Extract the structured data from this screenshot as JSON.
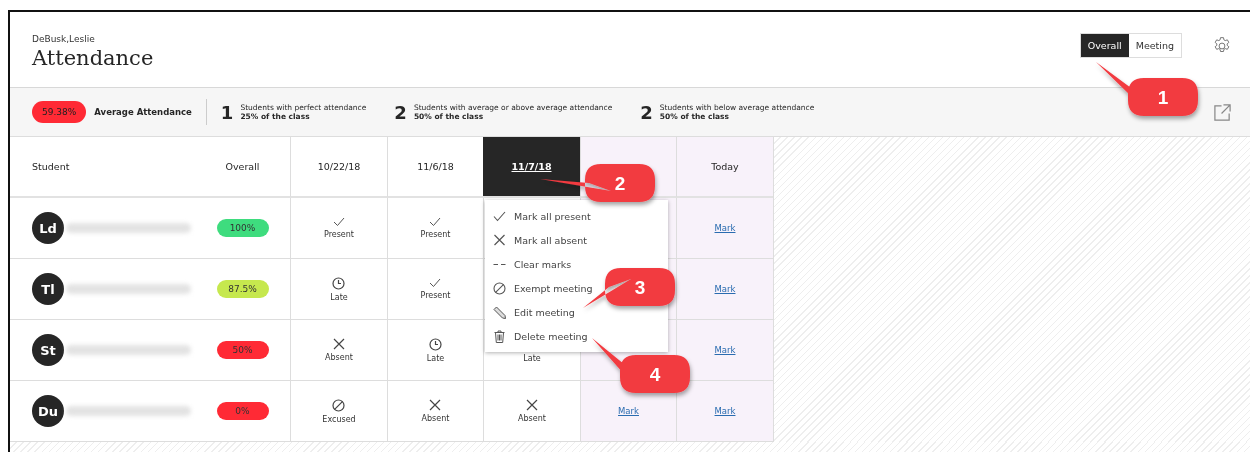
{
  "header": {
    "user_name": "DeBusk,Leslie",
    "title": "Attendance"
  },
  "view_tabs": [
    {
      "label": "Overall",
      "selected": true
    },
    {
      "label": "Meeting",
      "selected": false
    }
  ],
  "summary": {
    "average": {
      "value": "59.38%",
      "label": "Average Attendance",
      "color": "#ff2a35"
    },
    "stats": [
      {
        "count": "1",
        "description": "Students with perfect attendance",
        "share": "25% of the class"
      },
      {
        "count": "2",
        "description": "Students with average or above average attendance",
        "share": "50% of the class"
      },
      {
        "count": "2",
        "description": "Students with below average attendance",
        "share": "50% of the class"
      }
    ]
  },
  "table": {
    "columns": [
      {
        "label": "Student"
      },
      {
        "label": "Overall"
      }
    ],
    "meetings": [
      {
        "label": "10/22/18",
        "selected": false,
        "shaded": false
      },
      {
        "label": "11/6/18",
        "selected": false,
        "shaded": false
      },
      {
        "label": "11/7/18",
        "selected": true,
        "shaded": false
      },
      {
        "selected": false,
        "shaded": true
      },
      {
        "label": "Today",
        "selected": false,
        "shaded": true
      }
    ],
    "rows": [
      {
        "initials": "Ld",
        "overall": "100%",
        "color": "#3edc7e",
        "cells": [
          {
            "kind": "present",
            "label": "Present"
          },
          {
            "kind": "present",
            "label": "Present"
          },
          null,
          null,
          {
            "kind": "mark",
            "label": "Mark"
          }
        ]
      },
      {
        "initials": "Tl",
        "overall": "87.5%",
        "color": "#c6e84e",
        "cells": [
          {
            "kind": "late",
            "label": "Late"
          },
          {
            "kind": "present",
            "label": "Present"
          },
          null,
          null,
          {
            "kind": "mark",
            "label": "Mark"
          }
        ]
      },
      {
        "initials": "St",
        "overall": "50%",
        "color": "#ff2a35",
        "cells": [
          {
            "kind": "absent",
            "label": "Absent"
          },
          {
            "kind": "late",
            "label": "Late"
          },
          {
            "kind": "late",
            "label": "Late"
          },
          null,
          {
            "kind": "mark",
            "label": "Mark"
          }
        ]
      },
      {
        "initials": "Du",
        "overall": "0%",
        "color": "#ff2a35",
        "cells": [
          {
            "kind": "excused",
            "label": "Excused"
          },
          {
            "kind": "absent",
            "label": "Absent"
          },
          {
            "kind": "absent",
            "label": "Absent"
          },
          {
            "kind": "mark",
            "label": "Mark"
          },
          {
            "kind": "mark",
            "label": "Mark"
          }
        ]
      }
    ]
  },
  "meeting_menu": [
    {
      "kind": "check",
      "label": "Mark all present"
    },
    {
      "kind": "cross",
      "label": "Mark all absent"
    },
    {
      "kind": "dashes",
      "label": "Clear marks"
    },
    {
      "kind": "slash",
      "label": "Exempt meeting"
    },
    {
      "kind": "pencil",
      "label": "Edit meeting"
    },
    {
      "kind": "trash",
      "label": "Delete meeting"
    }
  ],
  "callouts": [
    {
      "number": "1"
    },
    {
      "number": "2"
    },
    {
      "number": "3"
    },
    {
      "number": "4"
    }
  ]
}
